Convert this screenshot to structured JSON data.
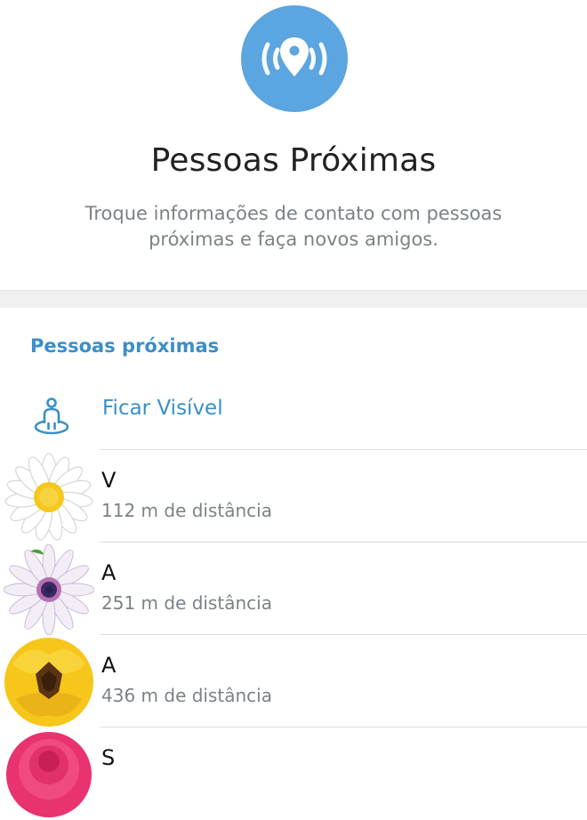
{
  "header": {
    "title": "Pessoas Próximas",
    "subtitle": "Troque informações de contato com pessoas próximas e faça novos amigos.",
    "hero_icon": "location-broadcast-icon",
    "hero_color": "#5ba5e0"
  },
  "section": {
    "title": "Pessoas próximas",
    "color": "#3a8fc8"
  },
  "make_visible": {
    "label": "Ficar Visível",
    "icon": "person-radar-icon"
  },
  "people": [
    {
      "name": "V",
      "distance": "112 m de distância",
      "avatar": "white-daisy"
    },
    {
      "name": "A",
      "distance": "251 m de distância",
      "avatar": "purple-daisy"
    },
    {
      "name": "A",
      "distance": "436 m de distância",
      "avatar": "yellow-tulip"
    },
    {
      "name": "S",
      "distance": "",
      "avatar": "pink-flower"
    }
  ]
}
